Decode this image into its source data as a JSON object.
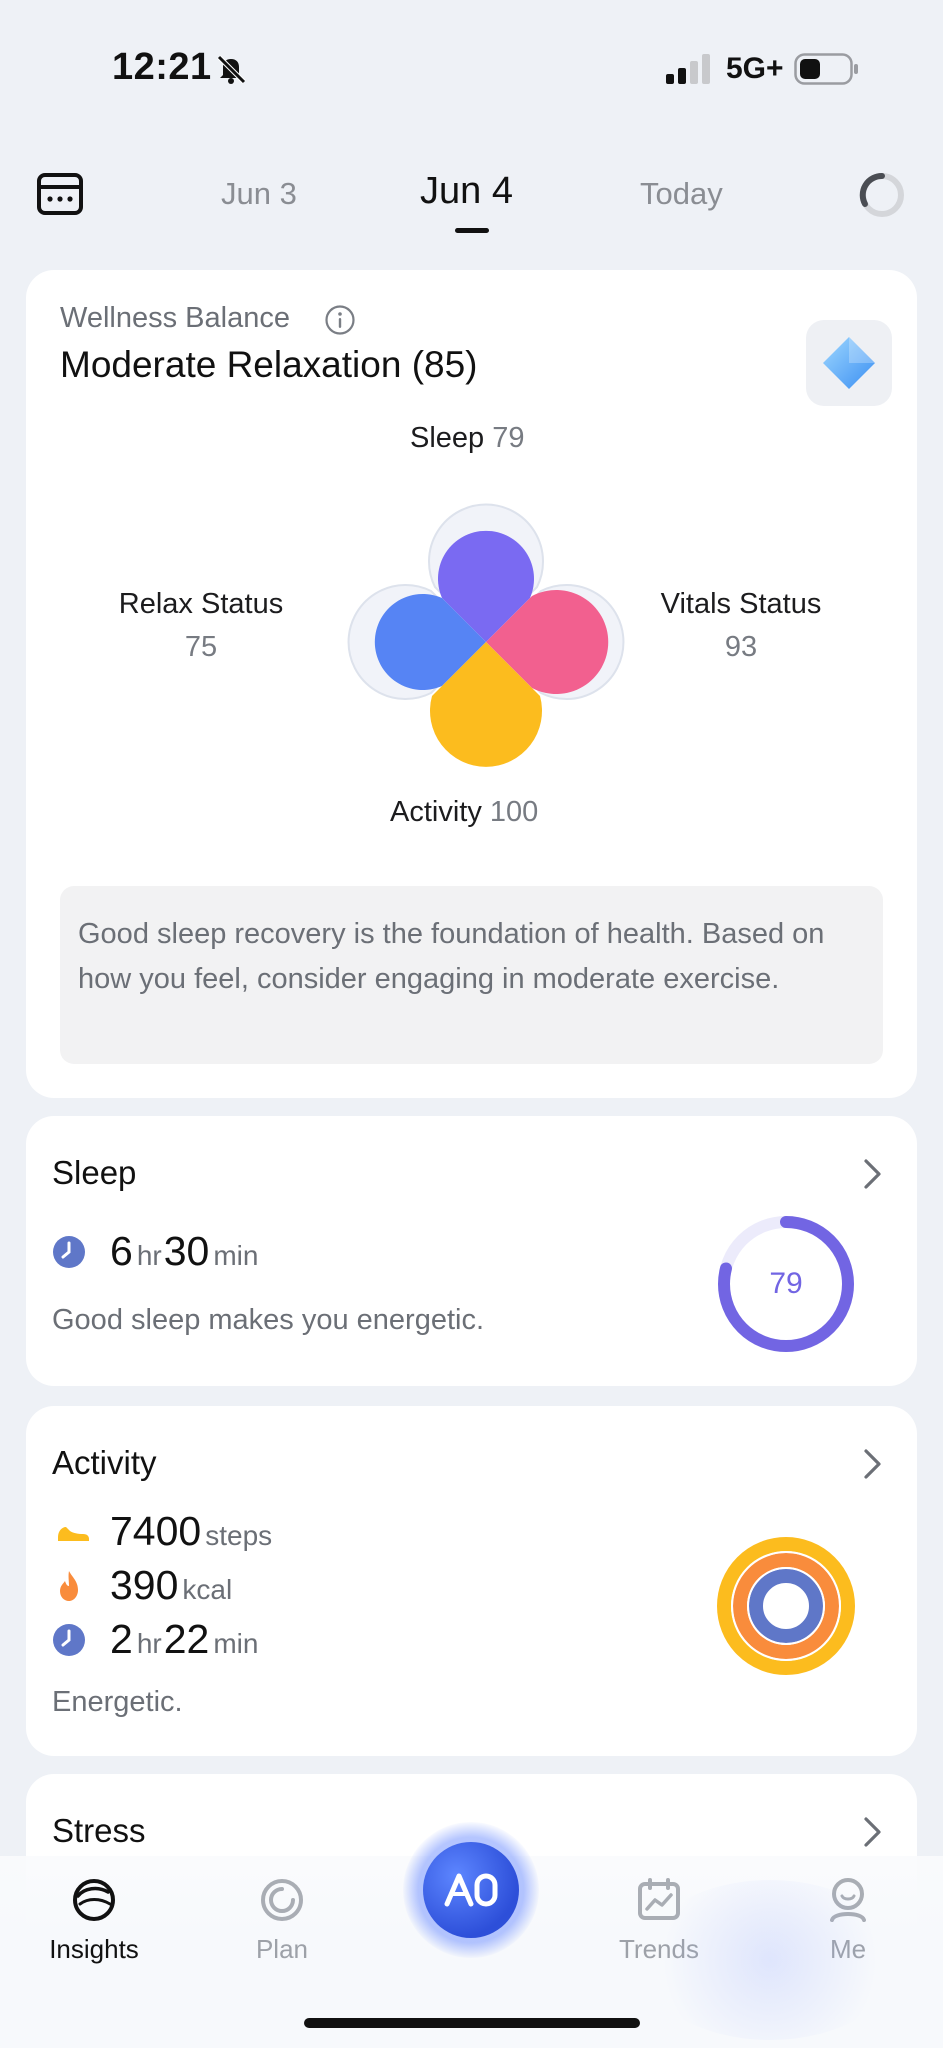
{
  "status_bar": {
    "time": "12:21",
    "network": "5G+"
  },
  "header": {
    "prev_date": "Jun 3",
    "current_date": "Jun 4",
    "next_date": "Today"
  },
  "wellness": {
    "label": "Wellness Balance",
    "title": "Moderate Relaxation (85)",
    "sleep": {
      "label": "Sleep",
      "value": "79"
    },
    "activity": {
      "label": "Activity",
      "value": "100"
    },
    "relax": {
      "label": "Relax Status",
      "value": "75"
    },
    "vitals": {
      "label": "Vitals Status",
      "value": "93"
    },
    "tip": "Good sleep recovery is the foundation of health. Based on how you feel, consider engaging in moderate exercise.",
    "colors": {
      "sleep": "#7a6af2",
      "vitals": "#f2608f",
      "activity": "#fcbc1e",
      "relax": "#5684f4"
    }
  },
  "sleep_card": {
    "title": "Sleep",
    "hours": "6",
    "hours_unit": "hr",
    "minutes": "30",
    "minutes_unit": "min",
    "description": "Good sleep makes you energetic.",
    "score": "79",
    "score_fraction": 0.79
  },
  "activity_card": {
    "title": "Activity",
    "steps": "7400",
    "steps_unit": "steps",
    "kcal": "390",
    "kcal_unit": "kcal",
    "hours": "2",
    "hours_unit": "hr",
    "minutes": "22",
    "minutes_unit": "min",
    "description": "Energetic."
  },
  "stress_card": {
    "title": "Stress"
  },
  "tabbar": {
    "insights": "Insights",
    "plan": "Plan",
    "ai": "AI",
    "trends": "Trends",
    "me": "Me"
  }
}
